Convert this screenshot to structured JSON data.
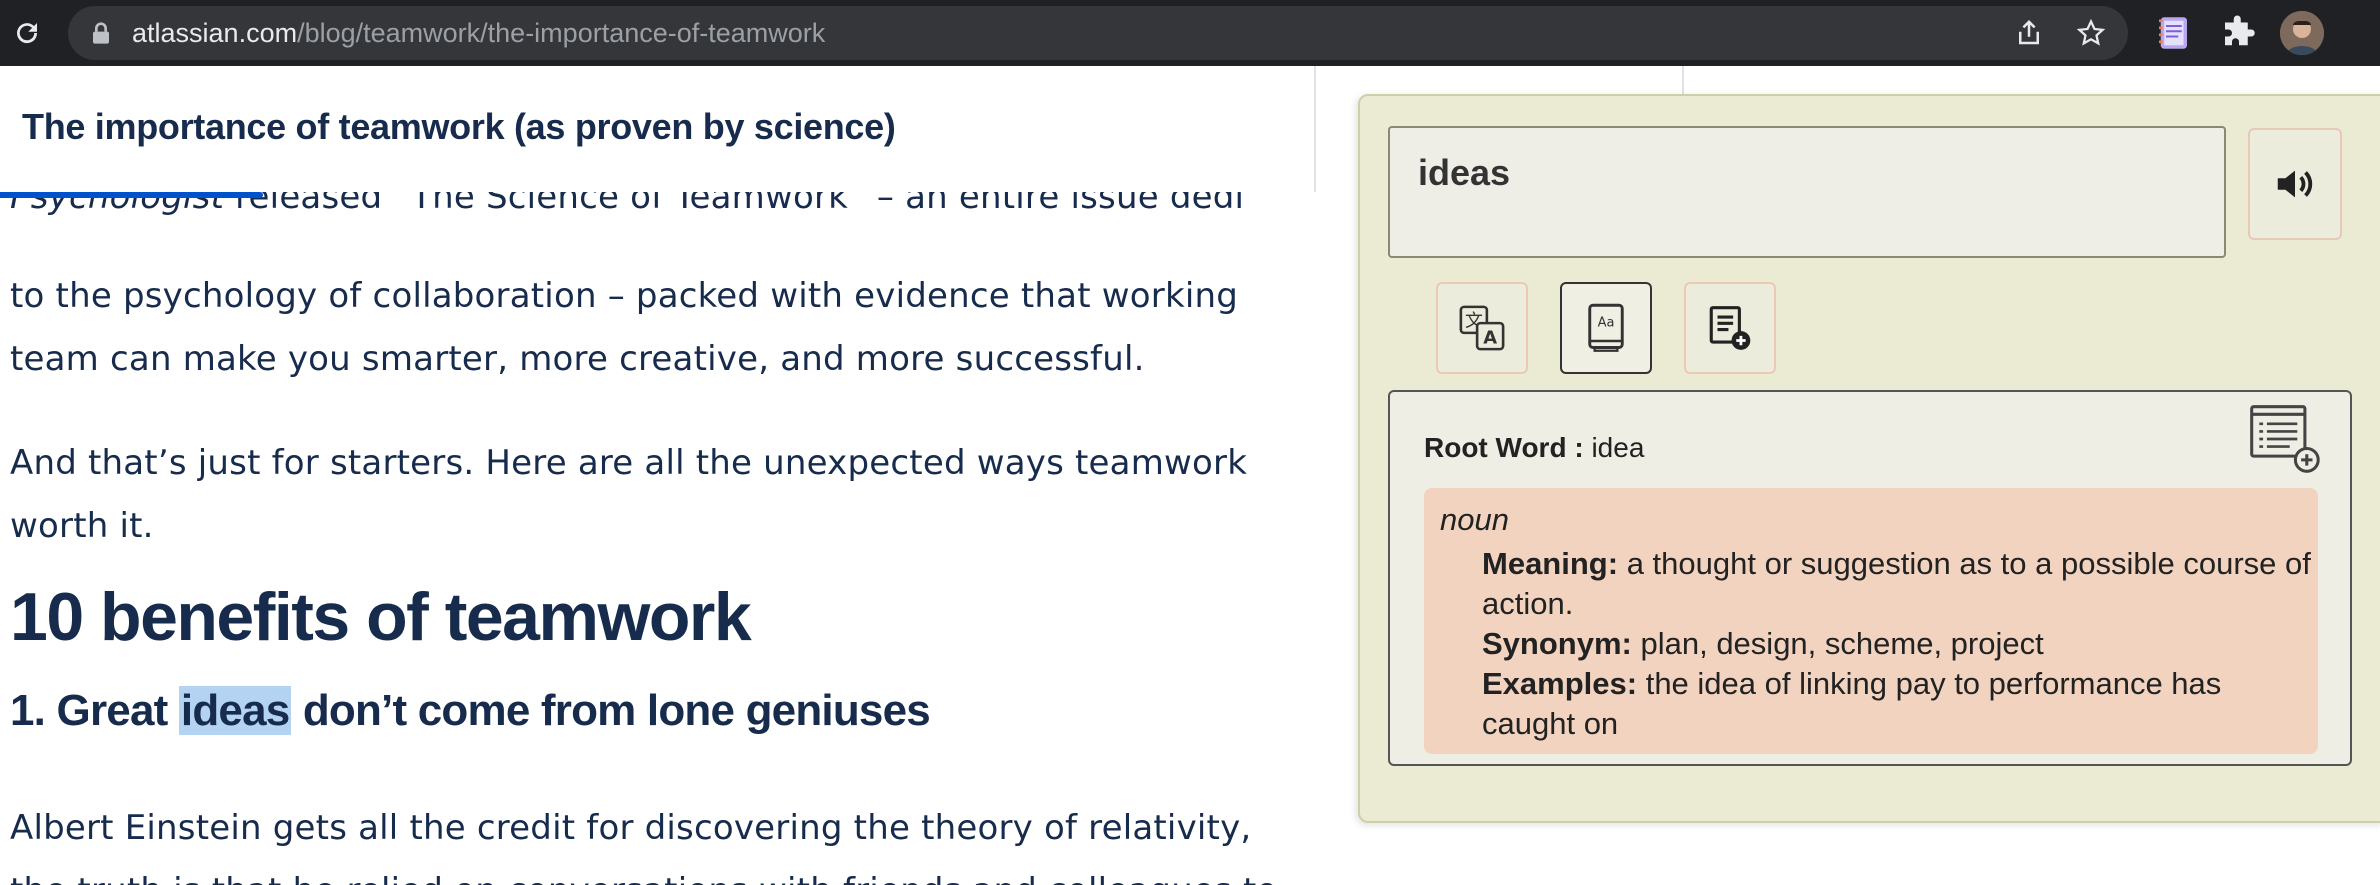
{
  "browser": {
    "url_host": "atlassian.com",
    "url_path": "/blog/teamwork/the-importance-of-teamwork",
    "icons": [
      "reload-icon",
      "lock-icon",
      "share-icon",
      "bookmark-star-icon",
      "extension-notebook-icon",
      "puzzle-extensions-icon",
      "profile-avatar"
    ]
  },
  "page": {
    "sticky_title": "The importance of teamwork (as proven by science)",
    "reading_progress": 0.2,
    "paragraphs": [
      {
        "before": "Psychologist",
        "text": " released  “The Science of Teamwork” – an entire issue dedi"
      },
      {
        "text": "to the psychology of collaboration – packed with evidence that working"
      },
      {
        "text": "team can make you smarter, more creative, and more successful."
      },
      {
        "text": "And that’s just for starters. Here are all the unexpected ways teamwork"
      },
      {
        "text": "worth it."
      }
    ],
    "heading": "10 benefits of teamwork",
    "subheading_before": "1. Great ",
    "subheading_highlight": "ideas",
    "subheading_after": " don’t come from lone geniuses",
    "body_lines": [
      "Albert Einstein gets all the credit for discovering the theory of relativity,",
      "the truth is that he relied on conversations with friends and colleagues to"
    ]
  },
  "dictionary": {
    "word": "ideas",
    "root_label": "Root Word :",
    "root_word": "idea",
    "part_of_speech": "noun",
    "meaning_label": "Meaning:",
    "meaning": "a thought or suggestion as to a possible course of action.",
    "synonym_label": "Synonym:",
    "synonyms": "plan, design, scheme, project",
    "examples_label": "Examples:",
    "examples": "the idea of linking pay to performance has caught on",
    "colors": {
      "panel": "#ebebd3",
      "sense_bg": "#f1d3c0",
      "highlight": "#b4d3f3",
      "progress": "#0052cc"
    }
  }
}
